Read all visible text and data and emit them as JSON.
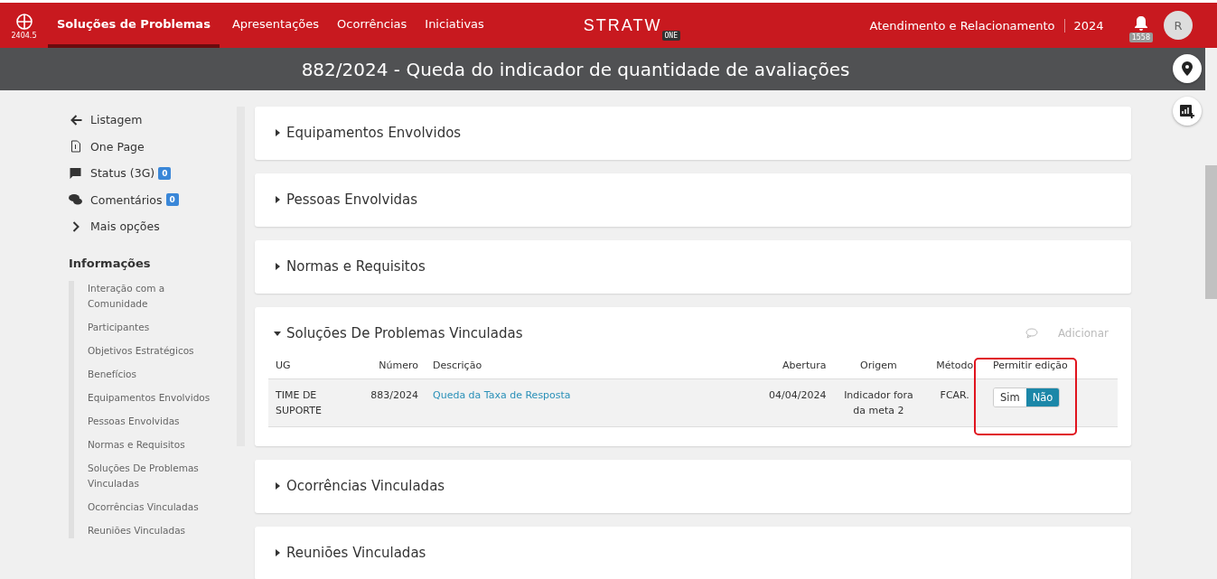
{
  "topbar": {
    "version": "2404.5",
    "nav": [
      {
        "label": "Soluções de Problemas",
        "selected": true
      },
      {
        "label": "Apresentações",
        "selected": false
      },
      {
        "label": "Ocorrências",
        "selected": false
      },
      {
        "label": "Iniciativas",
        "selected": false
      }
    ],
    "logo": {
      "text": "STRATW",
      "badge": "ONE"
    },
    "unit": "Atendimento e Relacionamento",
    "year": "2024",
    "notifications": "1558",
    "avatar": "R"
  },
  "title": "882/2024 - Queda do indicador de quantidade de avaliações",
  "sidebar": {
    "actions": [
      {
        "kind": "back",
        "label": "Listagem"
      },
      {
        "kind": "page",
        "label": "One Page"
      },
      {
        "kind": "status",
        "label": "Status (3G)",
        "count": "0"
      },
      {
        "kind": "comments",
        "label": "Comentários",
        "count": "0"
      },
      {
        "kind": "more",
        "label": "Mais opções"
      }
    ],
    "section": "Informações",
    "items": [
      "Interação com a Comunidade",
      "Participantes",
      "Objetivos Estratégicos",
      "Benefícios",
      "Equipamentos Envolvidos",
      "Pessoas Envolvidas",
      "Normas e Requisitos",
      "Soluções De Problemas Vinculadas",
      "Ocorrências Vinculadas",
      "Reuniões Vinculadas"
    ]
  },
  "panels": [
    {
      "title": "Equipamentos Envolvidos",
      "expanded": false
    },
    {
      "title": "Pessoas Envolvidas",
      "expanded": false
    },
    {
      "title": "Normas e Requisitos",
      "expanded": false
    },
    {
      "title": "Soluções De Problemas Vinculadas",
      "expanded": true,
      "action": "Adicionar",
      "table": {
        "columns": [
          "UG",
          "Número",
          "Descrição",
          "Abertura",
          "Origem",
          "Método",
          "Permitir edição"
        ],
        "rows": [
          {
            "ug": "TIME DE SUPORTE",
            "numero": "883/2024",
            "descricao": "Queda da Taxa de Resposta",
            "abertura": "04/04/2024",
            "origem": "Indicador fora da meta 2",
            "metodo": "FCAR.",
            "permitir": [
              {
                "label": "Sim",
                "selected": false
              },
              {
                "label": "Não",
                "selected": true
              }
            ]
          }
        ]
      }
    },
    {
      "title": "Ocorrências Vinculadas",
      "expanded": false
    },
    {
      "title": "Reuniões Vinculadas",
      "expanded": false
    }
  ]
}
